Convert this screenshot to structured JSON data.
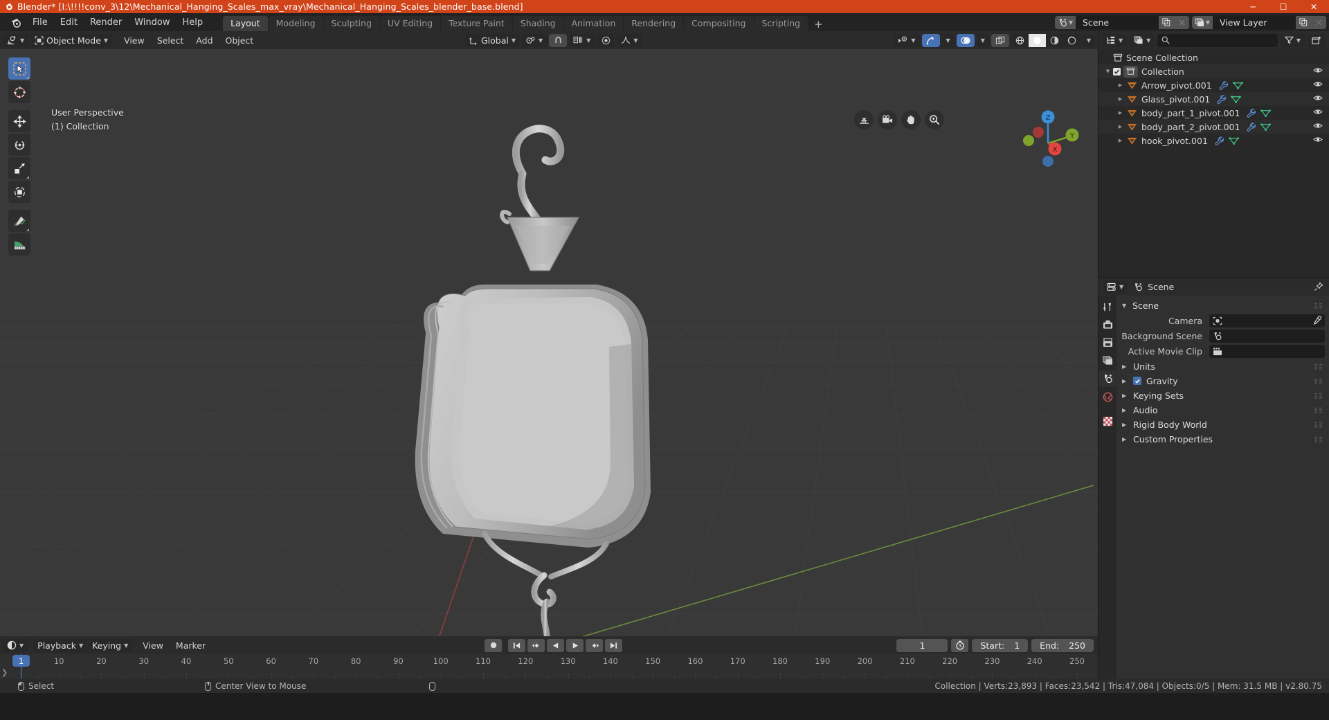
{
  "window": {
    "title": "Blender* [I:\\!!!!conv_3\\12\\Mechanical_Hanging_Scales_max_vray\\Mechanical_Hanging_Scales_blender_base.blend]",
    "minimize": "─",
    "maximize": "☐",
    "close": "✕",
    "accent": "#d14419"
  },
  "topbar": {
    "menus": [
      "File",
      "Edit",
      "Render",
      "Window",
      "Help"
    ],
    "workspaces": [
      {
        "label": "Layout",
        "active": true
      },
      {
        "label": "Modeling",
        "active": false
      },
      {
        "label": "Sculpting",
        "active": false
      },
      {
        "label": "UV Editing",
        "active": false
      },
      {
        "label": "Texture Paint",
        "active": false
      },
      {
        "label": "Shading",
        "active": false
      },
      {
        "label": "Animation",
        "active": false
      },
      {
        "label": "Rendering",
        "active": false
      },
      {
        "label": "Compositing",
        "active": false
      },
      {
        "label": "Scripting",
        "active": false
      }
    ],
    "add_workspace": "+",
    "scene_name": "Scene",
    "view_layer_name": "View Layer"
  },
  "viewport_header": {
    "mode": "Object Mode",
    "menus": [
      "View",
      "Select",
      "Add",
      "Object"
    ],
    "transform_orientation": "Global",
    "overlays_on": true,
    "xray_on": true,
    "shading_selected_index": 1
  },
  "viewport": {
    "perspective_label": "User Perspective",
    "collection_label": "(1) Collection",
    "gizmo_axes": {
      "z": "Z",
      "x": "X",
      "y": "Y"
    },
    "tools": [
      "tweak-select-box-tool",
      "cursor-tool",
      "move-tool",
      "rotate-tool",
      "scale-tool",
      "transform-tool",
      "annotate-tool",
      "measure-tool"
    ],
    "nav_buttons": [
      "grid-perspective-icon",
      "camera-view-icon",
      "hand-pan-icon",
      "zoom-magnifier-icon"
    ]
  },
  "timeline": {
    "editor_type": "timeline-editor-icon",
    "menus": [
      "Playback",
      "Keying",
      "View",
      "Marker"
    ],
    "transport": [
      "record-icon",
      "jump-start-icon",
      "prev-keyframe-icon",
      "play-reverse-icon",
      "play-icon",
      "next-keyframe-icon",
      "jump-end-icon"
    ],
    "current_frame": "1",
    "start_label": "Start:",
    "start_value": "1",
    "end_label": "End:",
    "end_value": "250",
    "ruler_ticks": [
      {
        "label": "1",
        "frame": 1
      },
      {
        "label": "10",
        "frame": 10
      },
      {
        "label": "20",
        "frame": 20
      },
      {
        "label": "30",
        "frame": 30
      },
      {
        "label": "40",
        "frame": 40
      },
      {
        "label": "50",
        "frame": 50
      },
      {
        "label": "60",
        "frame": 60
      },
      {
        "label": "70",
        "frame": 70
      },
      {
        "label": "80",
        "frame": 80
      },
      {
        "label": "90",
        "frame": 90
      },
      {
        "label": "100",
        "frame": 100
      },
      {
        "label": "110",
        "frame": 110
      },
      {
        "label": "120",
        "frame": 120
      },
      {
        "label": "130",
        "frame": 130
      },
      {
        "label": "140",
        "frame": 140
      },
      {
        "label": "150",
        "frame": 150
      },
      {
        "label": "160",
        "frame": 160
      },
      {
        "label": "170",
        "frame": 170
      },
      {
        "label": "180",
        "frame": 180
      },
      {
        "label": "190",
        "frame": 190
      },
      {
        "label": "200",
        "frame": 200
      },
      {
        "label": "210",
        "frame": 210
      },
      {
        "label": "220",
        "frame": 220
      },
      {
        "label": "230",
        "frame": 230
      },
      {
        "label": "240",
        "frame": 240
      },
      {
        "label": "250",
        "frame": 250
      }
    ],
    "playhead_frame": "1"
  },
  "outliner": {
    "search_placeholder": "",
    "scene_collection": "Scene Collection",
    "collection": "Collection",
    "items": [
      {
        "name": "Arrow_pivot.001",
        "modifier": true,
        "mesh": true
      },
      {
        "name": "Glass_pivot.001",
        "modifier": true,
        "mesh": true
      },
      {
        "name": "body_part_1_pivot.001",
        "modifier": true,
        "mesh": true
      },
      {
        "name": "body_part_2_pivot.001",
        "modifier": true,
        "mesh": true
      },
      {
        "name": "hook_pivot.001",
        "modifier": true,
        "mesh": true
      }
    ]
  },
  "properties": {
    "breadcrumb": "Scene",
    "panel_title": "Scene",
    "rows": [
      {
        "label": "Camera",
        "icon": "camera-data-icon",
        "value": "",
        "eyedropper": true
      },
      {
        "label": "Background Scene",
        "icon": "scene-data-icon",
        "value": "",
        "eyedropper": false
      },
      {
        "label": "Active Movie Clip",
        "icon": "movie-clip-icon",
        "value": "",
        "eyedropper": false
      }
    ],
    "sections": [
      {
        "label": "Units",
        "checkbox": null
      },
      {
        "label": "Gravity",
        "checkbox": true
      },
      {
        "label": "Keying Sets",
        "checkbox": null
      },
      {
        "label": "Audio",
        "checkbox": null
      },
      {
        "label": "Rigid Body World",
        "checkbox": null
      },
      {
        "label": "Custom Properties",
        "checkbox": null
      }
    ],
    "tabs": [
      "tool-icon",
      "render-icon",
      "output-icon",
      "view-layer-icon",
      "scene-icon",
      "world-icon",
      "texture-icon"
    ],
    "active_tab_index": 4
  },
  "statusbar": {
    "left_items": [
      {
        "mouse": "left",
        "label": "Select"
      },
      {
        "mouse": "middle",
        "label": "Center View to Mouse"
      },
      {
        "mouse": "right",
        "label": ""
      }
    ],
    "stats": "Collection | Verts:23,893 | Faces:23,542 | Tris:47,084 | Objects:0/5 | Mem: 31.5 MB | v2.80.75"
  }
}
